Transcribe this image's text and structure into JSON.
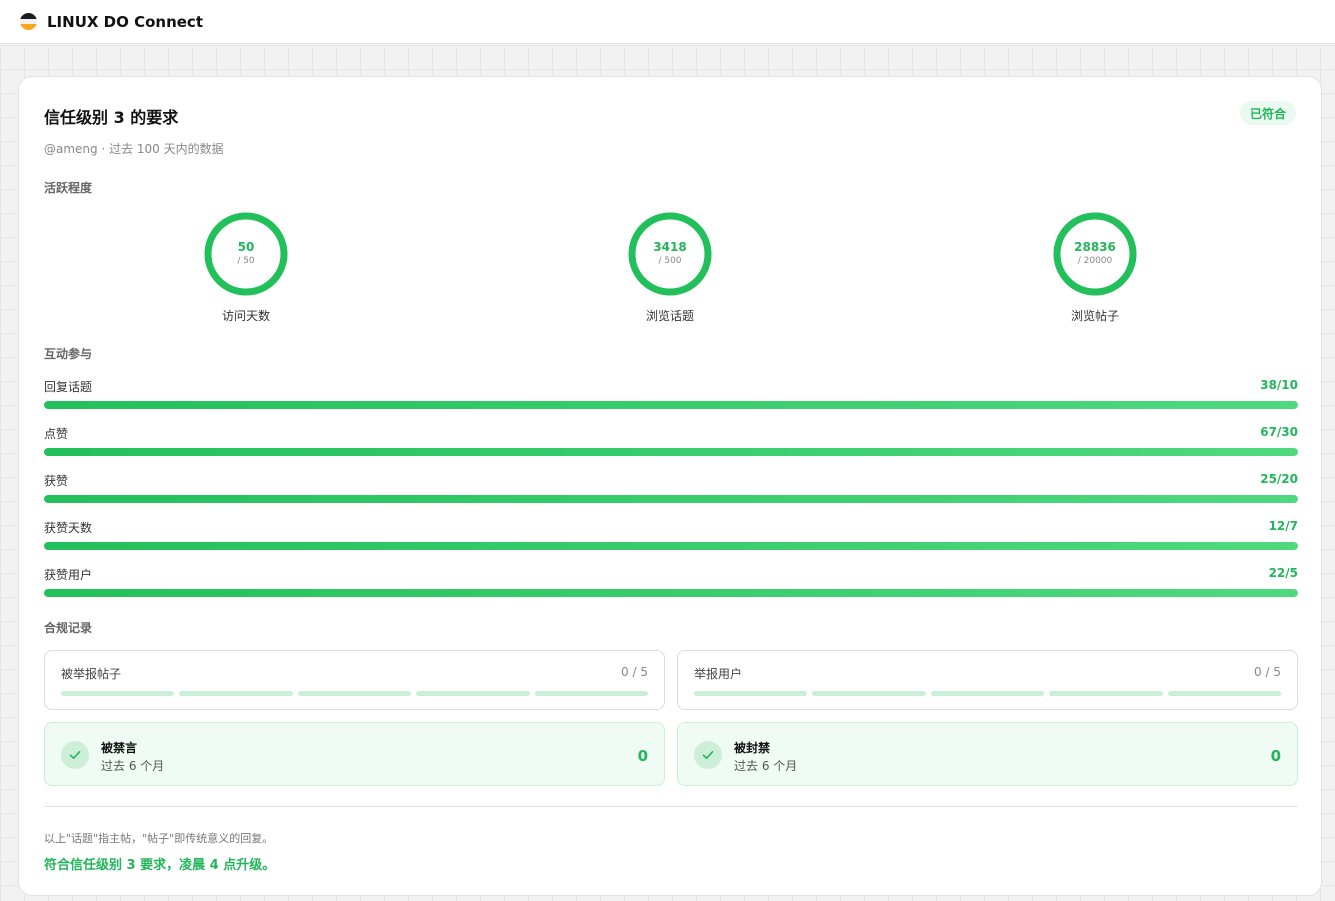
{
  "app": {
    "title": "LINUX DO Connect"
  },
  "card": {
    "title": "信任级别 3 的要求",
    "badge": "已符合",
    "subtitle": "@ameng · 过去 100 天内的数据"
  },
  "activity": {
    "label": "活跃程度",
    "rings": [
      {
        "value": "50",
        "max": "/ 50",
        "label": "访问天数",
        "fraction": 1.0
      },
      {
        "value": "3418",
        "max": "/ 500",
        "label": "浏览话题",
        "fraction": 1.0
      },
      {
        "value": "28836",
        "max": "/ 20000",
        "label": "浏览帖子",
        "fraction": 1.0
      }
    ]
  },
  "interaction": {
    "label": "互动参与",
    "bars": [
      {
        "label": "回复话题",
        "value": "38/10",
        "fraction": 1.0
      },
      {
        "label": "点赞",
        "value": "67/30",
        "fraction": 1.0
      },
      {
        "label": "获赞",
        "value": "25/20",
        "fraction": 1.0
      },
      {
        "label": "获赞天数",
        "value": "12/7",
        "fraction": 1.0
      },
      {
        "label": "获赞用户",
        "value": "22/5",
        "fraction": 1.0
      }
    ]
  },
  "compliance": {
    "label": "合规记录",
    "records": [
      {
        "name": "被举报帖子",
        "count": "0 / 5",
        "filled": 0,
        "segments": 5
      },
      {
        "name": "举报用户",
        "count": "0 / 5",
        "filled": 0,
        "segments": 5
      }
    ],
    "checks": [
      {
        "title": "被禁言",
        "sub": "过去 6 个月",
        "count": "0"
      },
      {
        "title": "被封禁",
        "sub": "过去 6 个月",
        "count": "0"
      }
    ]
  },
  "footer": {
    "note": "以上\"话题\"指主帖，\"帖子\"即传统意义的回复。",
    "result": "符合信任级别 3 要求，凌晨 4 点升级。"
  },
  "colors": {
    "accent": "#22c05a",
    "track": "#e4e4e4",
    "segment": "#c9efd6"
  }
}
